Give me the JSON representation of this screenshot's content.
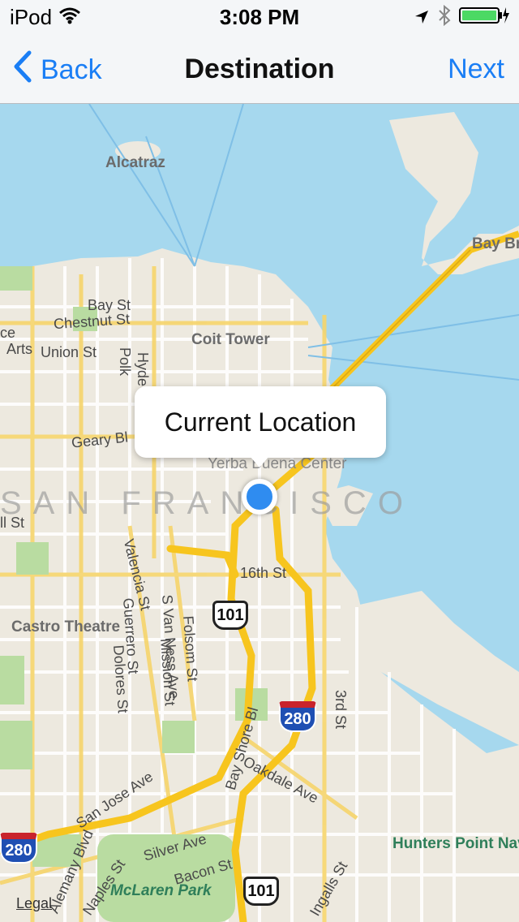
{
  "status_bar": {
    "carrier": "iPod",
    "time": "3:08 PM",
    "icons": [
      "wifi-icon",
      "location-arrow-icon",
      "bluetooth-icon",
      "battery-charging-icon"
    ]
  },
  "nav": {
    "back_label": "Back",
    "title": "Destination",
    "next_label": "Next",
    "accent_color": "#1a7ef5"
  },
  "map": {
    "callout_text": "Current Location",
    "city_label": "SAN FRANCISCO",
    "pois": {
      "alcatraz": "Alcatraz",
      "coit_tower": "Coit Tower",
      "castro_theatre": "Castro Theatre",
      "yerba_buena": "Yerba Buena Center",
      "bay_bridge": "Bay Br",
      "hunters_point": "Hunters Point Naval Facility",
      "mclaren_park": "McLaren Park"
    },
    "streets": {
      "bay_st": "Bay St",
      "chestnut_st": "Chestnut St",
      "union_st": "Union St",
      "arts": "Arts",
      "hyde": "Hyde",
      "polk": "Polk",
      "geary": "Geary Bl",
      "st_16": "16th St",
      "valencia": "Valencia St",
      "guerrero": "Guerrero St",
      "dolores": "Dolores St",
      "s_van_ness": "S Van Ness Ave",
      "mission": "Mission St",
      "folsom": "Folsom St",
      "bay_shore": "Bay Shore Bl",
      "third_st": "3rd St",
      "oakdale": "Oakdale Ave",
      "san_jose": "San Jose Ave",
      "silver": "Silver Ave",
      "bacon": "Bacon St",
      "alemany": "Alemany Blvd",
      "naples": "Naples St",
      "ingalls": "Ingalls St",
      "partial_st": "ll St",
      "partial_ce": "ce"
    },
    "shields": {
      "us101_a": "101",
      "i280_a": "280",
      "i280_b": "280",
      "us101_b": "101"
    },
    "legal_label": "Legal",
    "colors": {
      "water": "#a6d8ee",
      "land": "#ede9df",
      "highway": "#f7c51e",
      "park": "#b9dca1",
      "location_dot": "#2f8cf0"
    }
  }
}
